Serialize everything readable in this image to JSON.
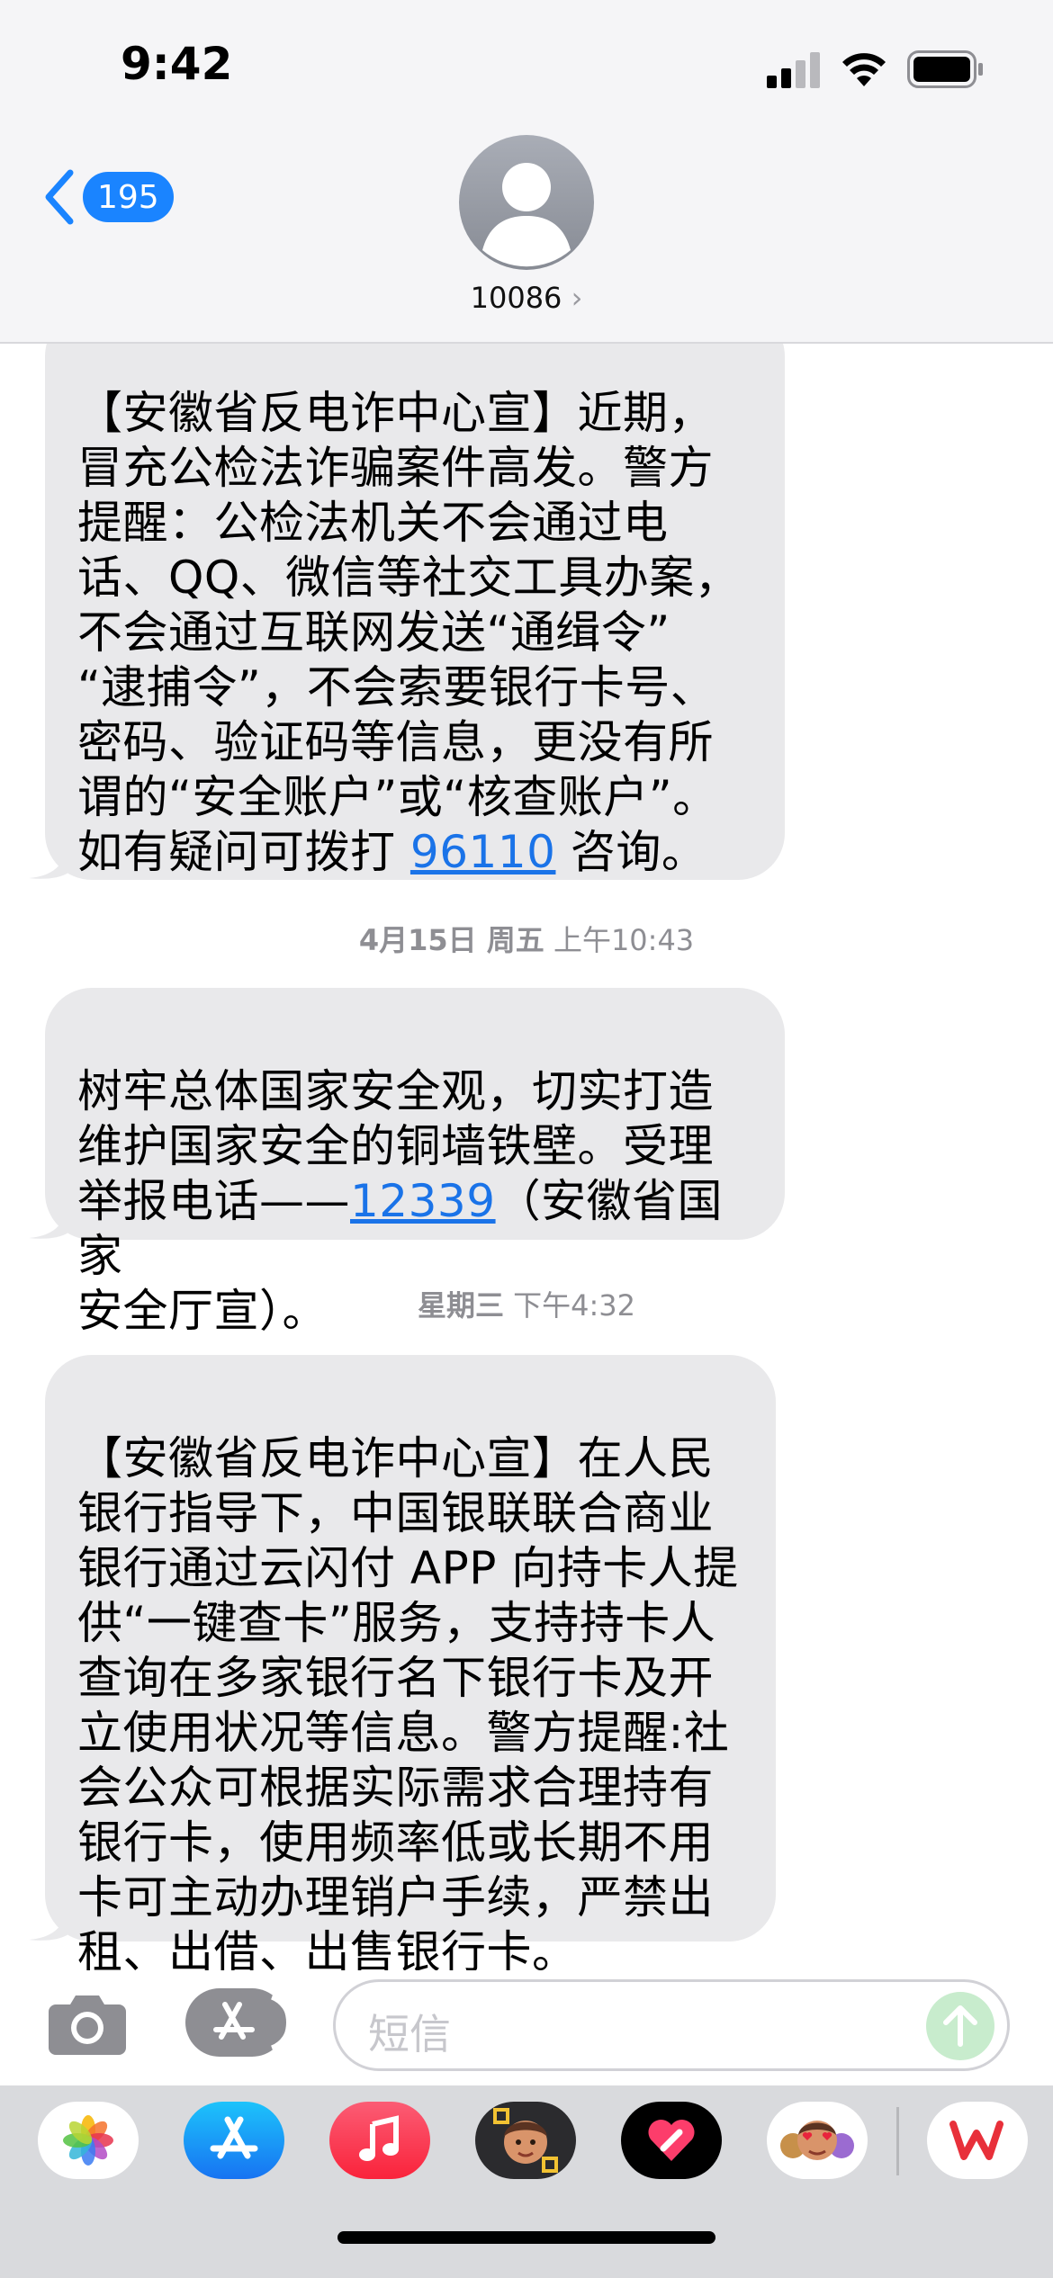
{
  "status_bar": {
    "time": "9:42"
  },
  "header": {
    "back_count": "195",
    "contact_name": "10086",
    "contact_chevron": "›"
  },
  "messages": [
    {
      "text_before": "【安徽省反电诈中心宣】近期，\n冒充公检法诈骗案件高发。警方\n提醒：公检法机关不会通过电\n话、QQ、微信等社交工具办案，\n不会通过互联网发送“通缉令”\n“逮捕令”，不会索要银行卡号、\n密码、验证码等信息，更没有所\n谓的“安全账户”或“核查账户”。\n如有疑问可拨打 ",
      "link": "96110",
      "text_after": " 咨询。"
    },
    {
      "timestamp_date": "4月15日 周五",
      "timestamp_time": " 上午10:43",
      "text_before": "树牢总体国家安全观，切实打造\n维护国家安全的铜墙铁壁。受理\n举报电话——",
      "link": "12339",
      "text_after": "（安徽省国家\n安全厅宣）。"
    },
    {
      "timestamp_date": "星期三",
      "timestamp_time": " 下午4:32",
      "text": "【安徽省反电诈中心宣】在人民\n银行指导下，中国银联联合商业\n银行通过云闪付 APP 向持卡人提\n供“一键查卡”服务，支持持卡人\n查询在多家银行名下银行卡及开\n立使用状况等信息。警方提醒:社\n会公众可根据实际需求合理持有\n银行卡，使用频率低或长期不用\n卡可主动办理销户手续，严禁出\n租、出借、出售银行卡。"
    }
  ],
  "input": {
    "placeholder": "短信"
  },
  "app_drawer": {
    "apps": [
      "photos-icon",
      "app-store-icon",
      "music-icon",
      "memoji-icon",
      "digital-touch-icon",
      "memoji-stickers-icon",
      "wps-icon"
    ]
  }
}
